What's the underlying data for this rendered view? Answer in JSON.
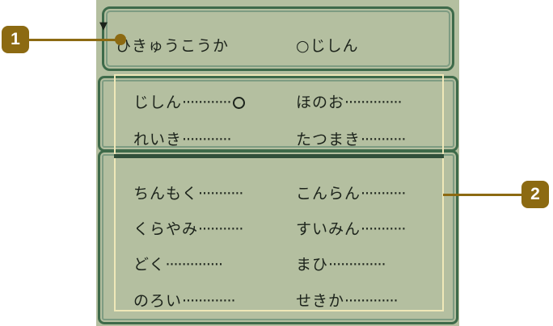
{
  "header": {
    "cursor": "▼",
    "selected_label": "ひきゅうこうか",
    "right_label": "○じしん"
  },
  "moves": [
    {
      "name": "じしん",
      "dots": "············",
      "marker": "○"
    },
    {
      "name": "ほのお",
      "dots": "··············",
      "marker": ""
    },
    {
      "name": "れいき",
      "dots": "············",
      "marker": ""
    },
    {
      "name": "たつまき",
      "dots": "···········",
      "marker": ""
    },
    {
      "name": "ちんもく",
      "dots": "···········",
      "marker": ""
    },
    {
      "name": "こんらん",
      "dots": "···········",
      "marker": ""
    },
    {
      "name": "くらやみ",
      "dots": "···········",
      "marker": ""
    },
    {
      "name": "すいみん",
      "dots": "···········",
      "marker": ""
    },
    {
      "name": "どく",
      "dots": "··············",
      "marker": ""
    },
    {
      "name": "まひ",
      "dots": "··············",
      "marker": ""
    },
    {
      "name": "のろい",
      "dots": "·············",
      "marker": ""
    },
    {
      "name": "せきか",
      "dots": "·············",
      "marker": ""
    }
  ],
  "callouts": {
    "one": "1",
    "two": "2"
  },
  "colors": {
    "screen_bg": "#b4bfa0",
    "frame": "#3e6a4a",
    "highlight": "#efe8b8",
    "callout": "#8c6a12"
  }
}
